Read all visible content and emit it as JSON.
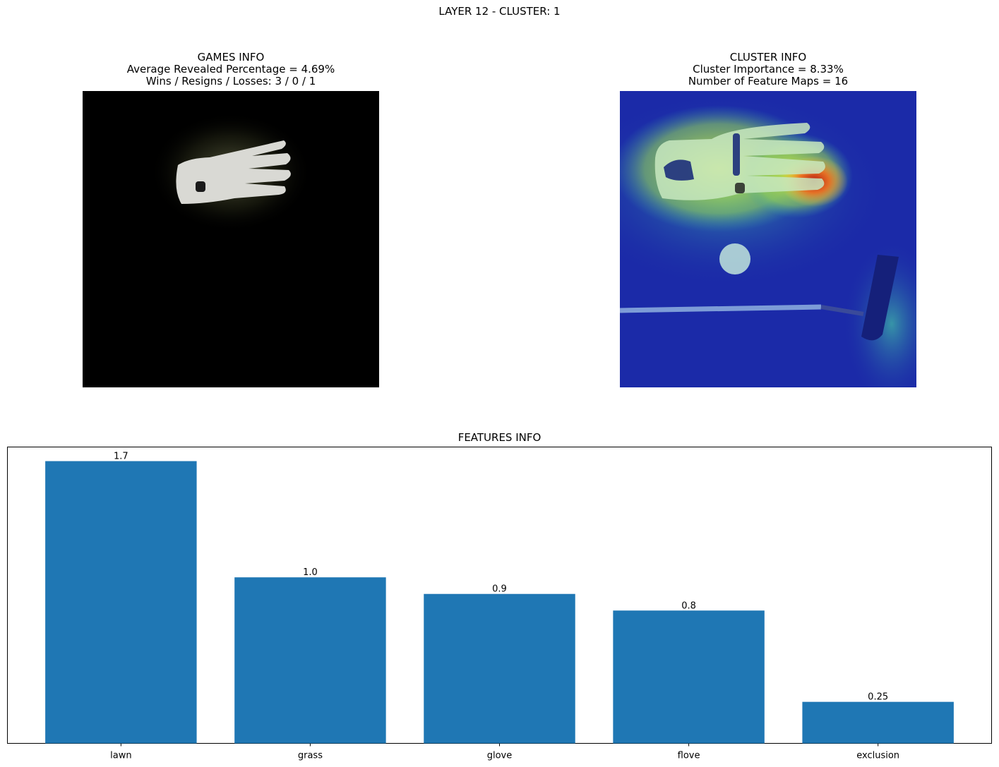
{
  "suptitle": "LAYER 12 - CLUSTER: 1",
  "games_info": {
    "title": "GAMES INFO",
    "line1": "Average Revealed Percentage = 4.69%",
    "line2": "Wins / Resigns / Losses: 3 / 0 / 1"
  },
  "cluster_info": {
    "title": "CLUSTER INFO",
    "line1": "Cluster Importance = 8.33%",
    "line2": "Number of Feature Maps = 16"
  },
  "features_info": {
    "title": "FEATURES INFO"
  },
  "colors": {
    "bar": "#1f77b4"
  },
  "chart_data": {
    "type": "bar",
    "title": "FEATURES INFO",
    "categories": [
      "lawn",
      "grass",
      "glove",
      "flove",
      "exclusion"
    ],
    "values": [
      1.7,
      1.0,
      0.9,
      0.8,
      0.25
    ],
    "value_labels": [
      "1.7",
      "1.0",
      "0.9",
      "0.8",
      "0.25"
    ],
    "xlabel": "",
    "ylabel": "",
    "ylim": [
      0,
      1.785
    ],
    "grid": false
  }
}
